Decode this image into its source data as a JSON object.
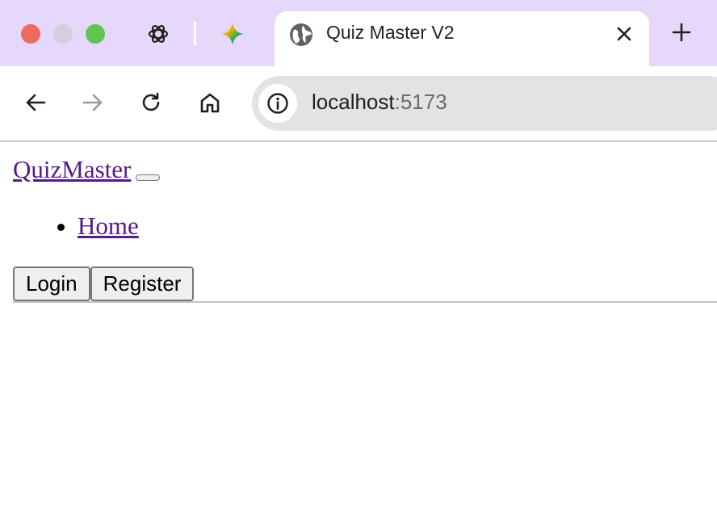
{
  "browser": {
    "window_controls": [
      "close",
      "minimize",
      "maximize"
    ],
    "pinned_tabs": [
      {
        "icon": "openai-icon"
      },
      {
        "icon": "gemini-icon"
      }
    ],
    "active_tab": {
      "title": "Quiz Master V2",
      "icon": "globe-icon"
    },
    "address": {
      "host": "localhost",
      "port": ":5173"
    },
    "colors": {
      "tab_strip": "#e6d8fa",
      "omnibox": "#e3e3e3"
    }
  },
  "page": {
    "brand": "QuizMaster",
    "nav_items": [
      "Home"
    ],
    "buttons": {
      "login": "Login",
      "register": "Register"
    },
    "colors": {
      "link": "#551a8b"
    }
  }
}
